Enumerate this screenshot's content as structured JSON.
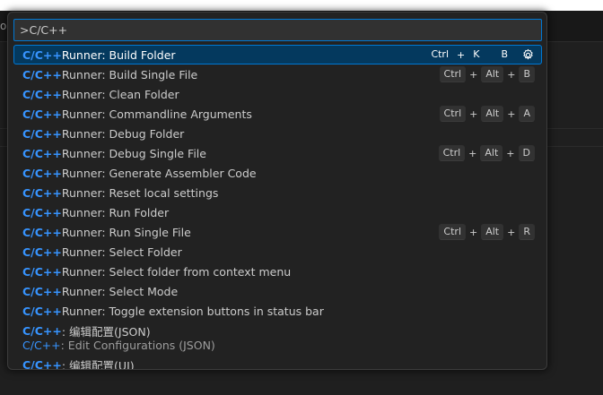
{
  "editor": {
    "tab_stub": "op"
  },
  "quick_input": {
    "value": ">C/C++",
    "rows": [
      {
        "hl": "C/C++",
        "rest": " Runner: Build Folder",
        "keys": [
          "Ctrl",
          "K",
          "B"
        ],
        "selected": true
      },
      {
        "hl": "C/C++",
        "rest": " Runner: Build Single File",
        "keys": [
          "Ctrl",
          "Alt",
          "B"
        ]
      },
      {
        "hl": "C/C++",
        "rest": " Runner: Clean Folder"
      },
      {
        "hl": "C/C++",
        "rest": " Runner: Commandline Arguments",
        "keys": [
          "Ctrl",
          "Alt",
          "A"
        ]
      },
      {
        "hl": "C/C++",
        "rest": " Runner: Debug Folder"
      },
      {
        "hl": "C/C++",
        "rest": " Runner: Debug Single File",
        "keys": [
          "Ctrl",
          "Alt",
          "D"
        ]
      },
      {
        "hl": "C/C++",
        "rest": " Runner: Generate Assembler Code"
      },
      {
        "hl": "C/C++",
        "rest": " Runner: Reset local settings"
      },
      {
        "hl": "C/C++",
        "rest": " Runner: Run Folder"
      },
      {
        "hl": "C/C++",
        "rest": " Runner: Run Single File",
        "keys": [
          "Ctrl",
          "Alt",
          "R"
        ]
      },
      {
        "hl": "C/C++",
        "rest": " Runner: Select Folder"
      },
      {
        "hl": "C/C++",
        "rest": " Runner: Select folder from context menu"
      },
      {
        "hl": "C/C++",
        "rest": " Runner: Select Mode"
      },
      {
        "hl": "C/C++",
        "rest": " Runner: Toggle extension buttons in status bar"
      },
      {
        "hl": "C/C++",
        "rest": ": 编辑配置(JSON)",
        "detail_hl": "C/C++",
        "detail_rest": ": Edit Configurations (JSON)"
      },
      {
        "hl": "C/C++",
        "rest": ": 编辑配置(UI)"
      }
    ],
    "gear_icon": "gear-icon"
  },
  "colors": {
    "accent": "#0078d4",
    "highlight": "#3794ff",
    "selected_bg": "#04395e"
  }
}
